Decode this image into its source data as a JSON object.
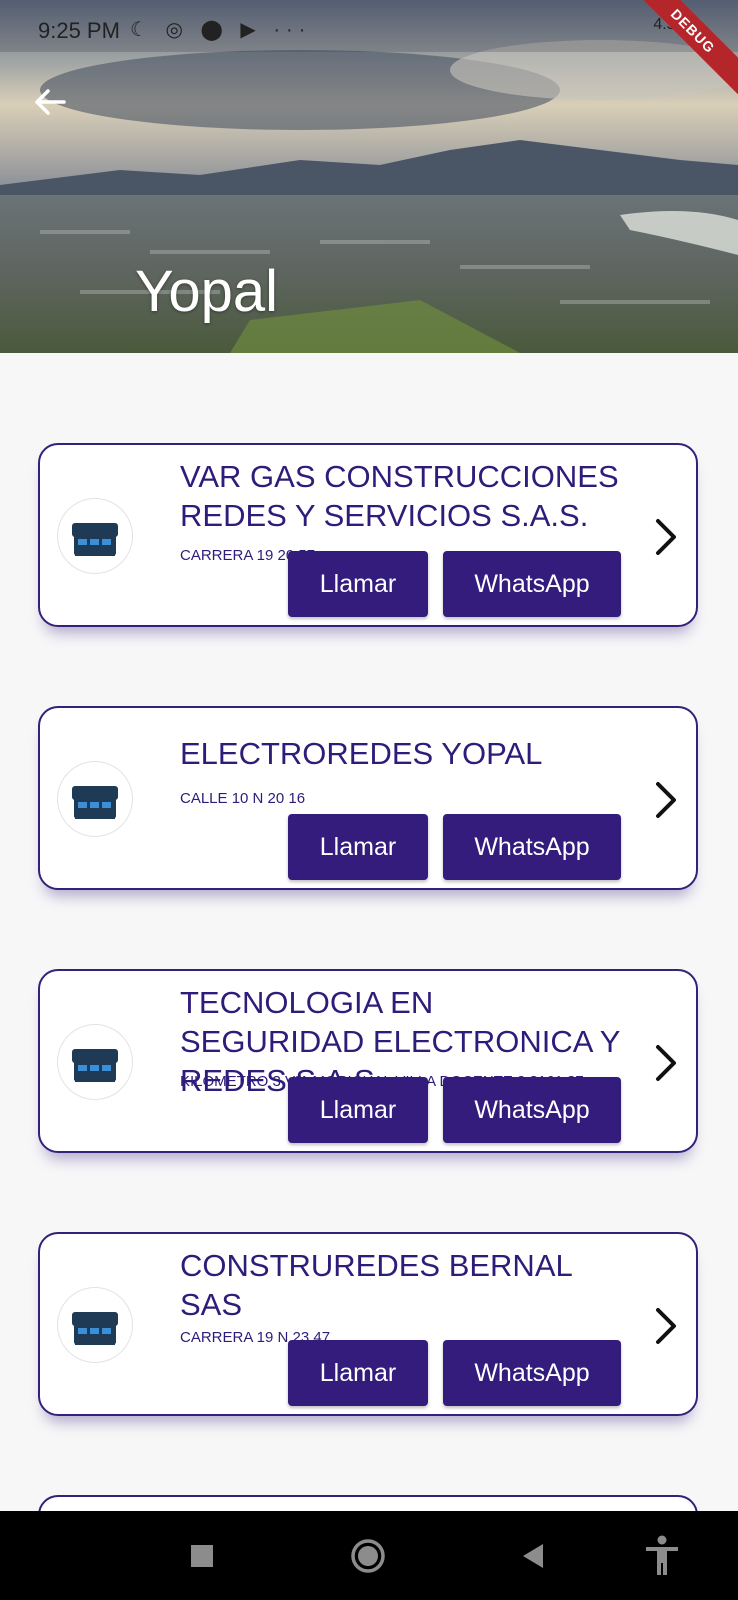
{
  "status_bar": {
    "time": "9:25 PM",
    "network_label": "4.5G",
    "debug_label": "DEBUG"
  },
  "header": {
    "title": "Yopal",
    "back_icon": "arrow-left-icon"
  },
  "listings": [
    {
      "name": "VAR GAS CONSTRUCCIONES REDES Y SERVICIOS S.A.S.",
      "address": "CARRERA 19 20 57",
      "call_label": "Llamar",
      "whatsapp_label": "WhatsApp"
    },
    {
      "name": "ELECTROREDES YOPAL",
      "address": "CALLE 10 N 20 16",
      "call_label": "Llamar",
      "whatsapp_label": "WhatsApp"
    },
    {
      "name": "TECNOLOGIA EN SEGURIDAD ELECTRONICA Y REDES S.A.S.",
      "address": "KILOMETRO 3 VIA MORICHAL VILLA DOCENTE 2 8161 87",
      "call_label": "Llamar",
      "whatsapp_label": "WhatsApp"
    },
    {
      "name": "CONSTRUREDES BERNAL SAS",
      "address": "CARRERA 19 N 23 47",
      "call_label": "Llamar",
      "whatsapp_label": "WhatsApp"
    }
  ],
  "colors": {
    "primary": "#331c7c",
    "text_primary": "#2f1c7a",
    "background": "#f7f7f8",
    "debug_banner": "#b5262b"
  }
}
